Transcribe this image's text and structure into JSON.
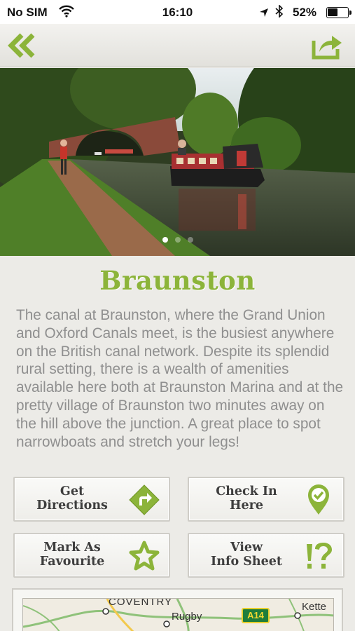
{
  "status_bar": {
    "carrier": "No SIM",
    "time": "16:10",
    "battery_percent": "52%",
    "battery_level": 0.52,
    "icons": [
      "wifi-icon",
      "location-arrow-icon",
      "bluetooth-icon",
      "battery-icon"
    ]
  },
  "nav": {
    "back_icon": "double-chevron-left-icon",
    "share_icon": "share-icon",
    "accent_color": "#8cb43a"
  },
  "hero": {
    "image": "narrowboat-on-canal-photo",
    "page_count": 3,
    "active_page": 1
  },
  "place": {
    "title": "Braunston",
    "description": "The canal at Braunston, where the Grand Union and Oxford Canals meet, is the busiest anywhere on the British canal network. Despite its splendid rural setting, there is a wealth of amenities available here both at Braunston Marina and at the pretty village of Braunston two minutes away on the hill above the junction. A great place to spot narrowboats and stretch your legs!"
  },
  "actions": {
    "directions": {
      "line1": "Get",
      "line2": "Directions",
      "icon": "directions-diamond-icon"
    },
    "checkin": {
      "line1": "Check In",
      "line2": "Here",
      "icon": "map-pin-check-icon"
    },
    "favourite": {
      "line1": "Mark As",
      "line2": "Favourite",
      "icon": "star-icon"
    },
    "infosheet": {
      "line1": "View",
      "line2": "Info Sheet",
      "icon": "exclamation-question-icon"
    }
  },
  "map": {
    "labels": {
      "coventry": "COVENTRY",
      "rugby": "Rugby",
      "road": "A14",
      "kettering": "Kette"
    }
  }
}
